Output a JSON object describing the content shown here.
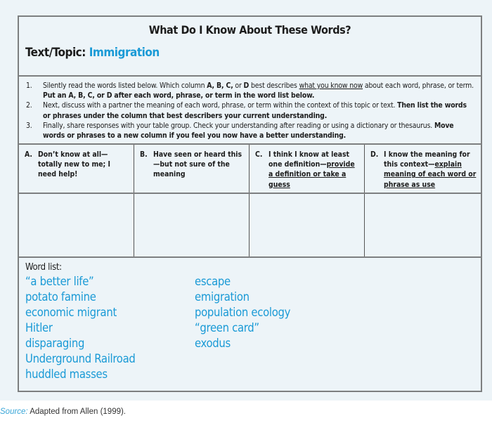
{
  "title": "What Do I Know About These Words?",
  "topic": {
    "label": "Text/Topic:",
    "value": "Immigration"
  },
  "instructions": [
    {
      "num": "1.",
      "parts": [
        {
          "t": "Silently read the words listed below. Which column ",
          "s": "n"
        },
        {
          "t": "A, B, C,",
          "s": "b"
        },
        {
          "t": " or ",
          "s": "n"
        },
        {
          "t": "D",
          "s": "b"
        },
        {
          "t": " best describes ",
          "s": "n"
        },
        {
          "t": "what you know now",
          "s": "u"
        },
        {
          "t": " about each word, phrase, or term. ",
          "s": "n"
        },
        {
          "t": "Put an A, B, C, or D after each word, phrase, or term in the word list below.",
          "s": "b"
        }
      ]
    },
    {
      "num": "2.",
      "parts": [
        {
          "t": "Next, discuss with a partner the meaning of each word, phrase, or term within the context of this topic or text. ",
          "s": "n"
        },
        {
          "t": "Then list the words or phrases under the column that best describers your current understanding.",
          "s": "b"
        }
      ]
    },
    {
      "num": "3.",
      "parts": [
        {
          "t": "Finally, share responses with your table group. Check your understanding after reading or using a dictionary or thesaurus. ",
          "s": "n"
        },
        {
          "t": "Move words or phrases to a new column if you feel you now have a better understanding.",
          "s": "b"
        }
      ]
    }
  ],
  "columns": [
    {
      "letter": "A.",
      "text": "Don’t know at all—totally new to me; I need help!",
      "underlined": ""
    },
    {
      "letter": "B.",
      "text": "Have seen or heard this—but not sure of the meaning",
      "underlined": ""
    },
    {
      "letter": "C.",
      "text": "I think I know at least one definition—",
      "underlined": "provide a definition or take a guess"
    },
    {
      "letter": "D.",
      "text": "I know the meaning for this context—",
      "underlined": "explain meaning of each word or phrase as use"
    }
  ],
  "word_list": {
    "label": "Word list:",
    "left": [
      "“a better life”",
      "potato famine",
      "economic migrant",
      "Hitler",
      "disparaging",
      "Underground Railroad",
      "huddled masses"
    ],
    "right": [
      "escape",
      "emigration",
      "population ecology",
      "“green card”",
      "exodus"
    ]
  },
  "source": {
    "label": "Source:",
    "text": " Adapted from Allen (1999)."
  },
  "colors": {
    "accent": "#1a9ad6",
    "panel_bg": "#edf4f8",
    "border": "#7d7f80"
  }
}
